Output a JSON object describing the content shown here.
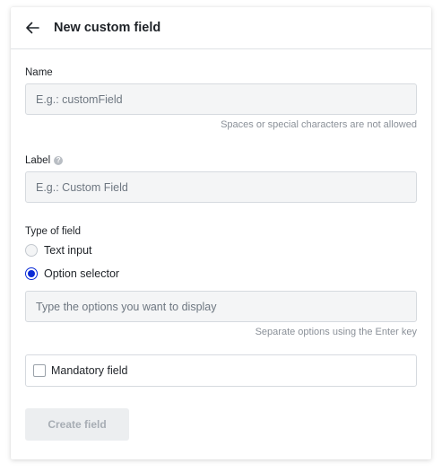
{
  "header": {
    "back_icon": "arrow-left-icon",
    "title": "New custom field"
  },
  "form": {
    "name": {
      "label": "Name",
      "value": "",
      "placeholder": "E.g.: customField",
      "hint": "Spaces or special characters are not allowed"
    },
    "label_field": {
      "label": "Label",
      "help_icon": "question-circle-icon",
      "help_glyph": "?",
      "value": "",
      "placeholder": "E.g.: Custom Field"
    },
    "type": {
      "label": "Type of field",
      "options": [
        {
          "label": "Text input",
          "checked": false
        },
        {
          "label": "Option selector",
          "checked": true
        }
      ],
      "options_input": {
        "value": "",
        "placeholder": "Type the options you want to display",
        "hint": "Separate options using the Enter key"
      }
    },
    "mandatory": {
      "label": "Mandatory field",
      "checked": false
    },
    "submit_label": "Create field",
    "submit_disabled": true
  },
  "colors": {
    "accent": "#0a2bd6",
    "input_bg": "#f4f5f6",
    "border": "#d6dadf",
    "hint_text": "#8a9098",
    "disabled_button_bg": "#eceef0",
    "disabled_button_text": "#a7adb4"
  }
}
